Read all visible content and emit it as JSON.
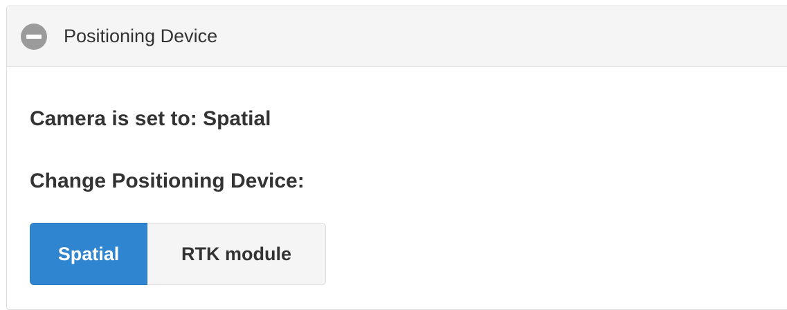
{
  "panel": {
    "title": "Positioning Device",
    "collapse_icon": "minus-circle-icon"
  },
  "status": {
    "text": "Camera is set to: Spatial"
  },
  "change": {
    "label": "Change Positioning Device:"
  },
  "device_options": [
    {
      "label": "Spatial",
      "selected": true
    },
    {
      "label": "RTK module",
      "selected": false
    }
  ],
  "colors": {
    "accent": "#2f85cf",
    "header_bg": "#f5f5f5",
    "icon_gray": "#9b9b9b",
    "text": "#333333"
  }
}
